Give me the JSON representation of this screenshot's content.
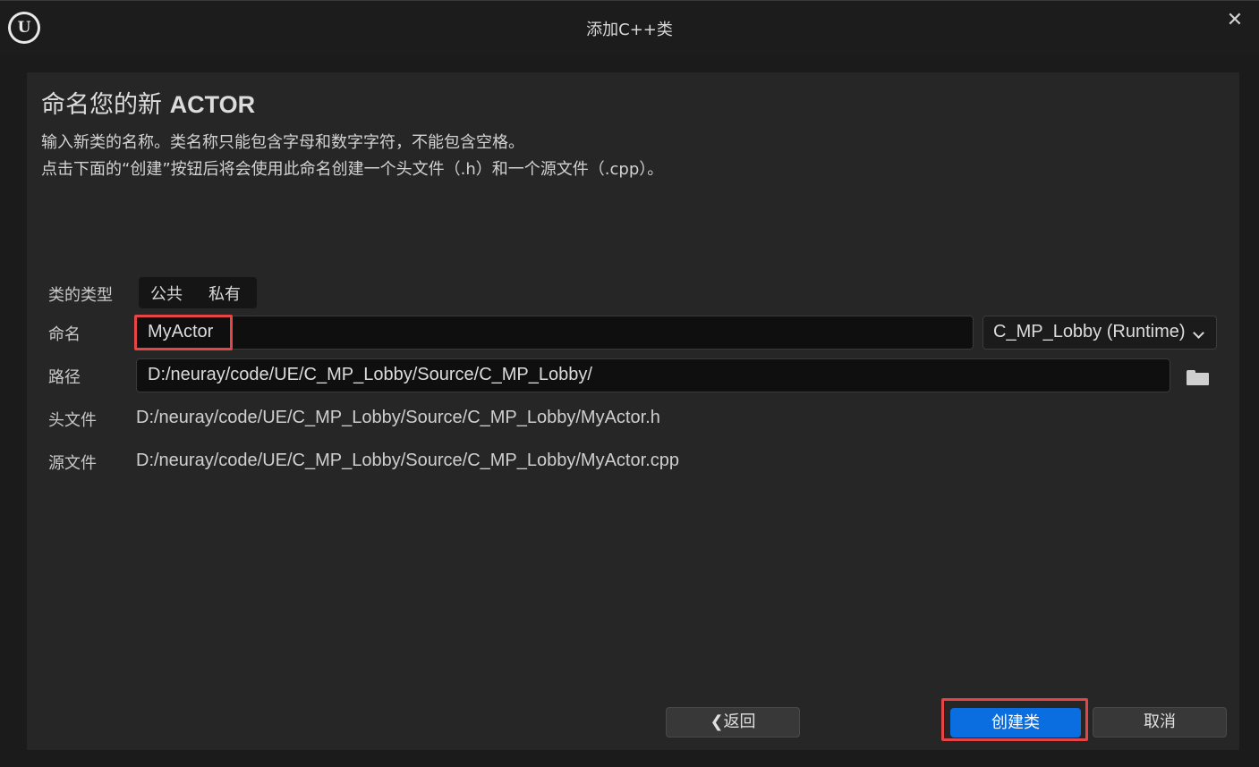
{
  "window": {
    "title": "添加C++类",
    "logo_text": "U",
    "close_symbol": "✕"
  },
  "header": {
    "title_prefix": "命名您的新",
    "title_class": "ACTOR",
    "description_line1": "输入新类的名称。类名称只能包含字母和数字字符，不能包含空格。",
    "description_line2": "点击下面的“创建”按钮后将会使用此命名创建一个头文件（.h）和一个源文件（.cpp）。"
  },
  "form": {
    "class_type": {
      "label": "类的类型",
      "options": [
        "公共",
        "私有"
      ]
    },
    "name": {
      "label": "命名",
      "value": "MyActor"
    },
    "module": {
      "value": "C_MP_Lobby (Runtime)"
    },
    "path": {
      "label": "路径",
      "value": "D:/neuray/code/UE/C_MP_Lobby/Source/C_MP_Lobby/"
    },
    "header_file": {
      "label": "头文件",
      "value": "D:/neuray/code/UE/C_MP_Lobby/Source/C_MP_Lobby/MyActor.h"
    },
    "source_file": {
      "label": "源文件",
      "value": "D:/neuray/code/UE/C_MP_Lobby/Source/C_MP_Lobby/MyActor.cpp"
    }
  },
  "footer": {
    "back_label": "❮返回",
    "create_label": "创建类",
    "cancel_label": "取消"
  },
  "colors": {
    "primary_button": "#0a6ee0",
    "highlight_border": "#e64545",
    "panel_bg": "#262626"
  }
}
